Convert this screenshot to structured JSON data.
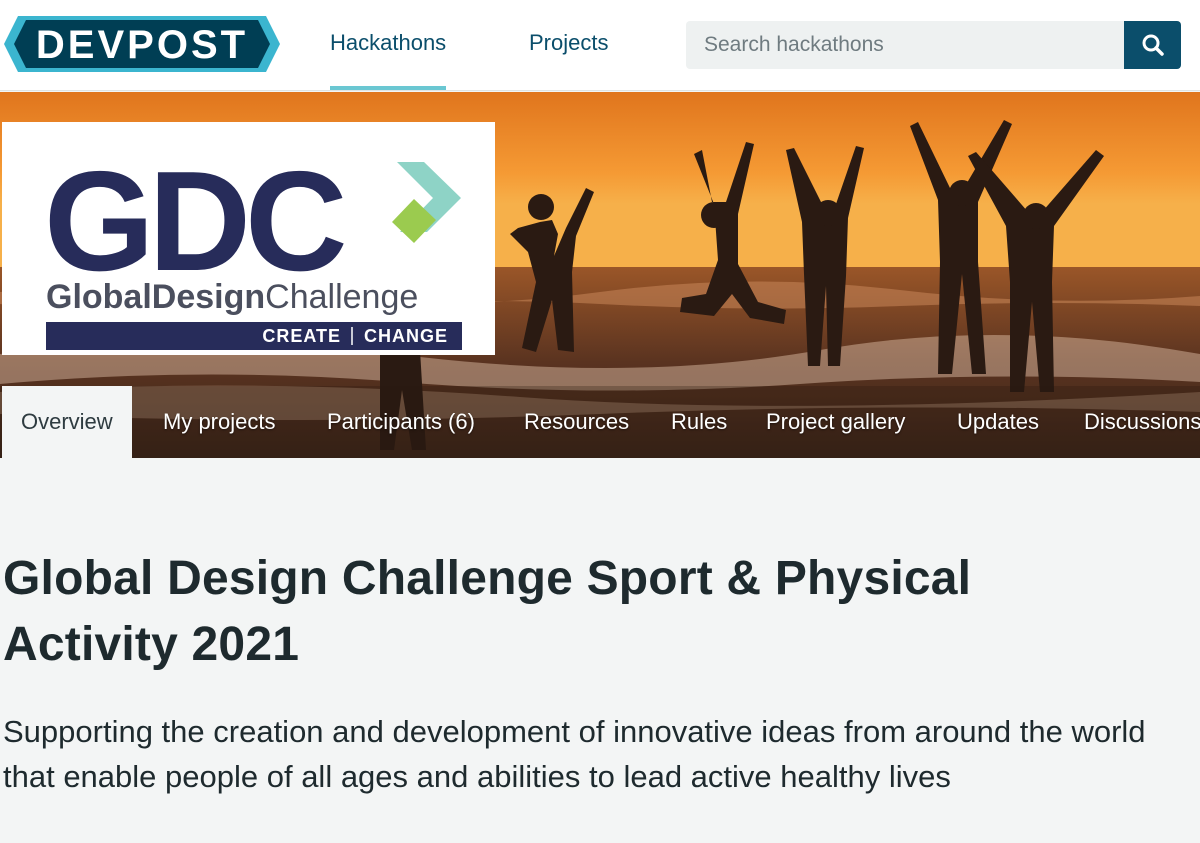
{
  "header": {
    "logo_text": "DEVPOST",
    "nav": [
      {
        "label": "Hackathons",
        "active": true
      },
      {
        "label": "Projects",
        "active": false
      }
    ],
    "search": {
      "placeholder": "Search hackathons",
      "value": ""
    },
    "search_icon": "search-icon"
  },
  "banner": {
    "logo": {
      "mark": "GDC",
      "name_bold": "GlobalDesign",
      "name_light": "Challenge",
      "tag_left": "CREATE",
      "tag_right": "CHANGE"
    },
    "image_subject": "silhouettes of people jumping on a beach at sunset"
  },
  "tabs": [
    {
      "label": "Overview",
      "active": true
    },
    {
      "label": "My projects",
      "active": false
    },
    {
      "label": "Participants (6)",
      "active": false
    },
    {
      "label": "Resources",
      "active": false
    },
    {
      "label": "Rules",
      "active": false
    },
    {
      "label": "Project gallery",
      "active": false
    },
    {
      "label": "Updates",
      "active": false
    },
    {
      "label": "Discussions",
      "active": false
    }
  ],
  "challenge": {
    "title": "Global Design Challenge Sport & Physical Activity 2021",
    "tagline": "Supporting the creation and development of innovative ideas from around the world that enable people of all ages and abilities to lead active healthy lives"
  },
  "colors": {
    "brand_navy": "#0b4e6b",
    "brand_cyan": "#6ac7d2",
    "gdc_navy": "#272c5a",
    "gdc_teal": "#8ed3c6",
    "gdc_green": "#9bcb4f",
    "sunset_orange": "#f08a24",
    "page_background": "#f3f5f5"
  }
}
